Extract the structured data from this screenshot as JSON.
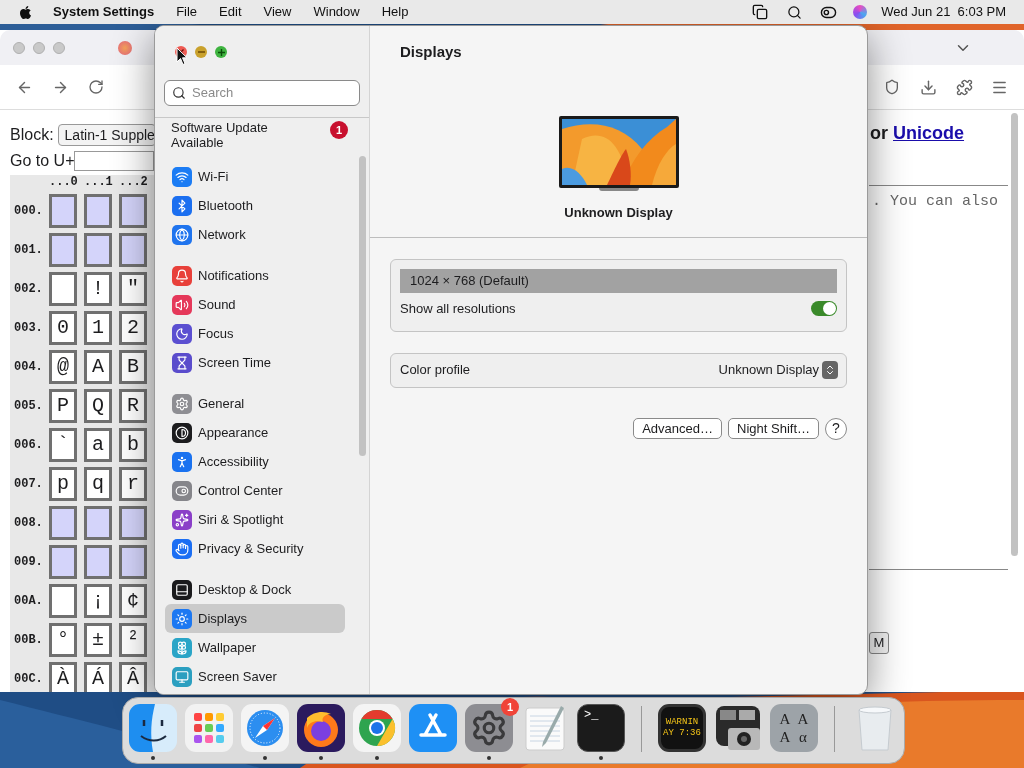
{
  "menu_bar": {
    "app_name": "System Settings",
    "menus": [
      "File",
      "Edit",
      "View",
      "Window",
      "Help"
    ],
    "clock": "Wed Jun 21  6:03 PM"
  },
  "browser": {
    "block_label": "Block:",
    "block_select": "Latin-1 Supple",
    "goto_label": "Go to U+",
    "heading": "or ",
    "heading_link": "Unicode",
    "mono_text": ". You can also",
    "cut_button": "M",
    "char_table": {
      "columns": [
        "...0",
        "...1",
        "...2"
      ],
      "rows": [
        {
          "label": "000.",
          "cells": [
            {
              "kind": "control"
            },
            {
              "kind": "control"
            },
            {
              "kind": "control"
            }
          ]
        },
        {
          "label": "001.",
          "cells": [
            {
              "kind": "control"
            },
            {
              "kind": "control"
            },
            {
              "kind": "control"
            }
          ]
        },
        {
          "label": "002.",
          "cells": [
            {
              "kind": "blank"
            },
            {
              "kind": "glyph",
              "char": "!"
            },
            {
              "kind": "glyph",
              "char": "\""
            }
          ]
        },
        {
          "label": "003.",
          "cells": [
            {
              "kind": "glyph",
              "char": "0"
            },
            {
              "kind": "glyph",
              "char": "1"
            },
            {
              "kind": "glyph",
              "char": "2"
            }
          ]
        },
        {
          "label": "004.",
          "cells": [
            {
              "kind": "glyph",
              "char": "@"
            },
            {
              "kind": "glyph",
              "char": "A"
            },
            {
              "kind": "glyph",
              "char": "B"
            }
          ]
        },
        {
          "label": "005.",
          "cells": [
            {
              "kind": "glyph",
              "char": "P"
            },
            {
              "kind": "glyph",
              "char": "Q"
            },
            {
              "kind": "glyph",
              "char": "R"
            }
          ]
        },
        {
          "label": "006.",
          "cells": [
            {
              "kind": "glyph",
              "char": "`"
            },
            {
              "kind": "glyph",
              "char": "a"
            },
            {
              "kind": "glyph",
              "char": "b"
            }
          ]
        },
        {
          "label": "007.",
          "cells": [
            {
              "kind": "glyph",
              "char": "p"
            },
            {
              "kind": "glyph",
              "char": "q"
            },
            {
              "kind": "glyph",
              "char": "r"
            }
          ]
        },
        {
          "label": "008.",
          "cells": [
            {
              "kind": "control"
            },
            {
              "kind": "control"
            },
            {
              "kind": "control"
            }
          ]
        },
        {
          "label": "009.",
          "cells": [
            {
              "kind": "control"
            },
            {
              "kind": "control"
            },
            {
              "kind": "control"
            }
          ]
        },
        {
          "label": "00A.",
          "cells": [
            {
              "kind": "blank"
            },
            {
              "kind": "glyph",
              "char": "¡"
            },
            {
              "kind": "glyph",
              "char": "¢"
            }
          ]
        },
        {
          "label": "00B.",
          "cells": [
            {
              "kind": "glyph",
              "char": "°"
            },
            {
              "kind": "glyph",
              "char": "±"
            },
            {
              "kind": "glyph",
              "char": "²"
            }
          ]
        },
        {
          "label": "00C.",
          "cells": [
            {
              "kind": "glyph",
              "char": "À"
            },
            {
              "kind": "glyph",
              "char": "Á"
            },
            {
              "kind": "glyph",
              "char": "Â"
            }
          ]
        }
      ]
    }
  },
  "settings": {
    "search": {
      "placeholder": "Search"
    },
    "update_notice": {
      "text": "Software Update Available",
      "badge": "1"
    },
    "sidebar_groups": [
      {
        "items": [
          {
            "label": "Wi-Fi",
            "color": "#1b7cf4",
            "selected": false
          },
          {
            "label": "Bluetooth",
            "color": "#1b6ff0",
            "selected": false
          },
          {
            "label": "Network",
            "color": "#1f74ee",
            "selected": false
          }
        ]
      },
      {
        "items": [
          {
            "label": "Notifications",
            "color": "#e8403a",
            "selected": false
          },
          {
            "label": "Sound",
            "color": "#e5385a",
            "selected": false
          },
          {
            "label": "Focus",
            "color": "#5b4fd1",
            "selected": false
          },
          {
            "label": "Screen Time",
            "color": "#5a4ccc",
            "selected": false
          }
        ]
      },
      {
        "items": [
          {
            "label": "General",
            "color": "#8e8e93",
            "selected": false
          },
          {
            "label": "Appearance",
            "color": "#1c1c1e",
            "selected": false
          },
          {
            "label": "Accessibility",
            "color": "#1a72f0",
            "selected": false
          },
          {
            "label": "Control Center",
            "color": "#85858a",
            "selected": false
          },
          {
            "label": "Siri & Spotlight",
            "color": "#8a3fc8",
            "selected": false
          },
          {
            "label": "Privacy & Security",
            "color": "#1b6ef3",
            "selected": false
          }
        ]
      },
      {
        "items": [
          {
            "label": "Desktop & Dock",
            "color": "#1a1a1c",
            "selected": false
          },
          {
            "label": "Displays",
            "color": "#1c78f2",
            "selected": true
          },
          {
            "label": "Wallpaper",
            "color": "#2aa5c7",
            "selected": false
          },
          {
            "label": "Screen Saver",
            "color": "#2b9fc0",
            "selected": false
          }
        ]
      }
    ],
    "title": "Displays",
    "display_name": "Unknown Display",
    "resolution": {
      "label": "1024 × 768 (Default)",
      "selected": true
    },
    "show_all": {
      "label": "Show all resolutions",
      "on": true
    },
    "color_profile": {
      "label": "Color profile",
      "value": "Unknown Display"
    },
    "buttons": [
      "Advanced…",
      "Night Shift…"
    ],
    "help": "?"
  },
  "dock": {
    "apps": [
      {
        "kind": "finder",
        "running": true
      },
      {
        "kind": "launchpad",
        "running": false
      },
      {
        "kind": "safari",
        "running": true
      },
      {
        "kind": "firefox",
        "running": true
      },
      {
        "kind": "chrome",
        "running": true
      },
      {
        "kind": "appstore",
        "running": false
      },
      {
        "kind": "settings",
        "running": true,
        "badge": "1"
      },
      {
        "kind": "textedit",
        "running": false
      },
      {
        "kind": "terminal",
        "running": true,
        "glyph": ">_"
      },
      {
        "kind": "separator"
      },
      {
        "kind": "console",
        "running": false,
        "lines": [
          "WARNIN",
          "AY 7:36"
        ]
      },
      {
        "kind": "capture",
        "running": false
      },
      {
        "kind": "fontbook",
        "running": false,
        "glyphs": [
          "A",
          "A",
          "A",
          "α"
        ]
      },
      {
        "kind": "separator"
      },
      {
        "kind": "trash",
        "running": false
      }
    ]
  }
}
